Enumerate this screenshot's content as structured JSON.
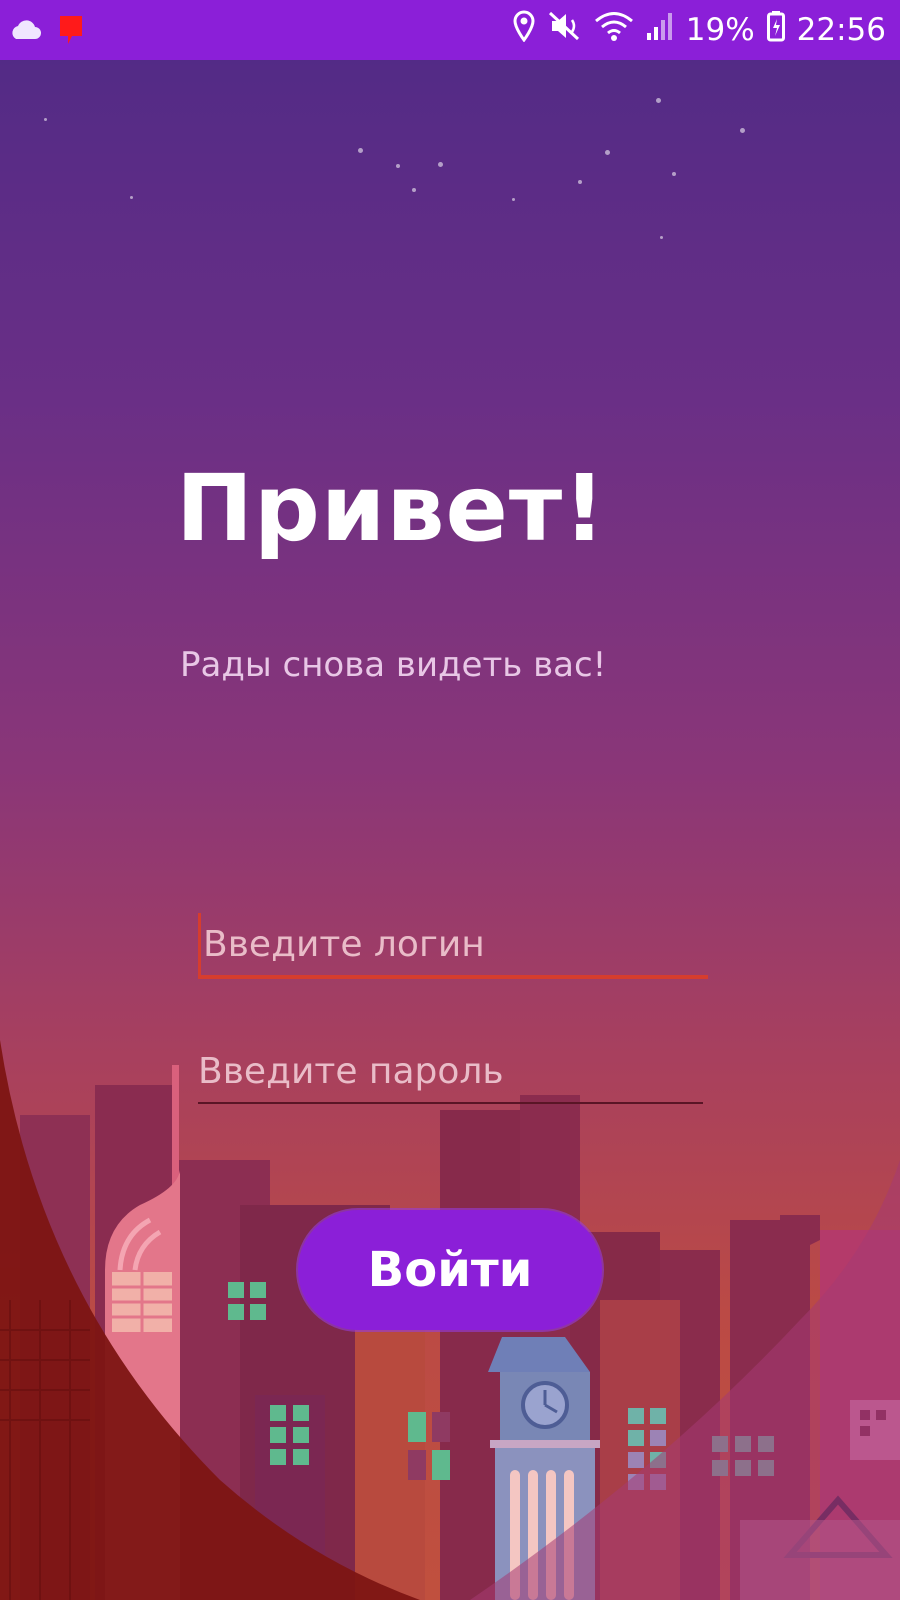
{
  "status_bar": {
    "battery_percent": "19%",
    "time": "22:56",
    "icons": [
      "cloud-icon",
      "notification-icon",
      "location-icon",
      "mute-icon",
      "wifi-icon",
      "signal-icon",
      "battery-icon"
    ]
  },
  "login_screen": {
    "title": "Привет!",
    "subtitle": "Рады снова видеть вас!",
    "login_placeholder": "Введите логин",
    "password_placeholder": "Введите пароль",
    "login_button": "Войти"
  },
  "colors": {
    "accent": "#8b1fd8",
    "input_focus": "#d63d2e",
    "dark_wave": "#7d1513"
  }
}
